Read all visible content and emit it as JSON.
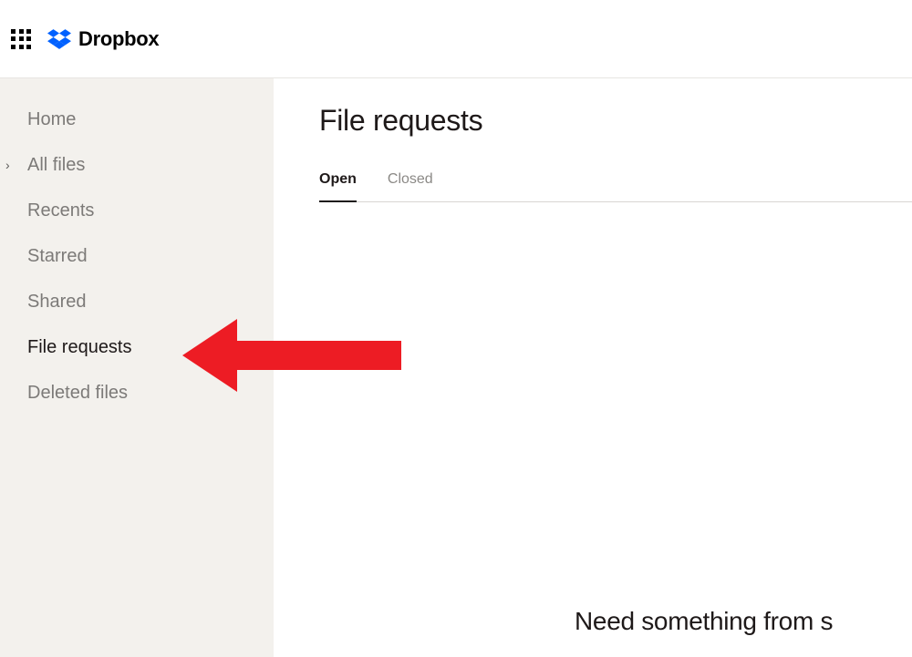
{
  "topbar": {
    "brand_name": "Dropbox"
  },
  "sidebar": {
    "items": [
      {
        "label": "Home",
        "active": false,
        "expandable": false
      },
      {
        "label": "All files",
        "active": false,
        "expandable": true
      },
      {
        "label": "Recents",
        "active": false,
        "expandable": false
      },
      {
        "label": "Starred",
        "active": false,
        "expandable": false
      },
      {
        "label": "Shared",
        "active": false,
        "expandable": false
      },
      {
        "label": "File requests",
        "active": true,
        "expandable": false
      },
      {
        "label": "Deleted files",
        "active": false,
        "expandable": false
      }
    ]
  },
  "main": {
    "title": "File requests",
    "tabs": [
      {
        "label": "Open",
        "active": true
      },
      {
        "label": "Closed",
        "active": false
      }
    ],
    "empty_caption": "Need something from s"
  },
  "annotation": {
    "arrow_color": "#ed1c24",
    "target": "File requests"
  },
  "colors": {
    "brand_blue": "#0061ff",
    "sidebar_bg": "#f3f1ed",
    "text_muted": "#7c7a78",
    "text_primary": "#1e1919"
  }
}
